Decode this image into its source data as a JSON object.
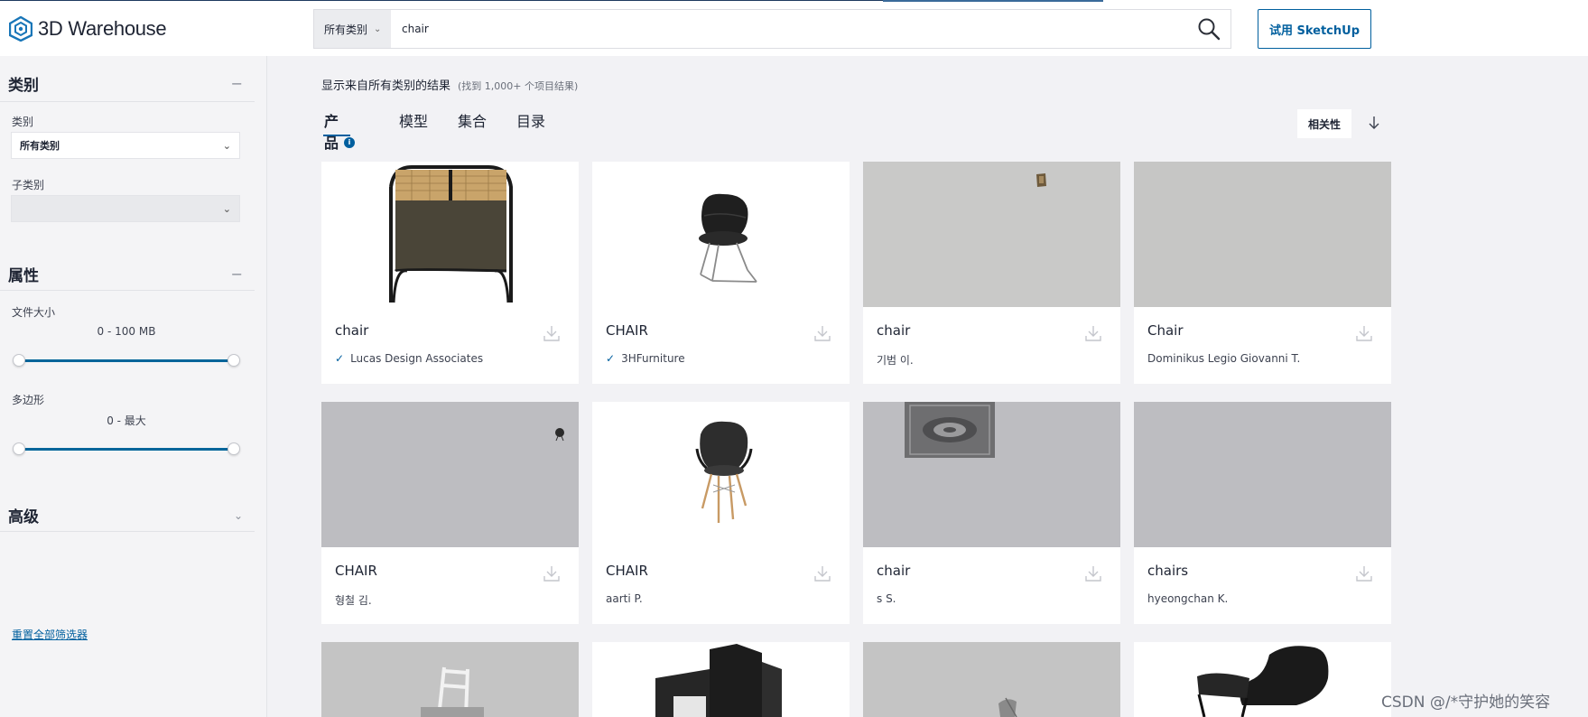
{
  "header": {
    "logo_text": "3D Warehouse",
    "search_category": "所有类别",
    "search_value": "chair",
    "try_button": "试用 SketchUp"
  },
  "sidebar": {
    "category_section": "类别",
    "category_label": "类别",
    "category_value": "所有类别",
    "subcategory_label": "子类别",
    "subcategory_value": "",
    "attributes_section": "属性",
    "filesize_label": "文件大小",
    "filesize_range": "0 - 100 MB",
    "polygon_label": "多边形",
    "polygon_range": "0 - 最大",
    "advanced_section": "高级",
    "reset_link": "重置全部筛选器"
  },
  "main": {
    "result_text": "显示来自所有类别的结果",
    "result_count": "(找到 1,000+ 个项目结果)",
    "tabs": [
      {
        "label": "产品"
      },
      {
        "label": "模型"
      },
      {
        "label": "集合"
      },
      {
        "label": "目录"
      }
    ],
    "sort_label": "相关性",
    "cards": [
      {
        "title": "chair",
        "author": "Lucas Design Associates",
        "verified": true,
        "thumb_bg": "#ffffff"
      },
      {
        "title": "CHAIR",
        "author": "3HFurniture",
        "verified": true,
        "thumb_bg": "#ffffff"
      },
      {
        "title": "chair",
        "author": "기범 이.",
        "verified": false,
        "thumb_bg": "#c9c9c8"
      },
      {
        "title": "Chair",
        "author": "Dominikus Legio Giovanni T.",
        "verified": false,
        "thumb_bg": "#c6c6c5"
      },
      {
        "title": "CHAIR",
        "author": "형철 김.",
        "verified": false,
        "thumb_bg": "#bdbdc1"
      },
      {
        "title": "CHAIR",
        "author": "aarti P.",
        "verified": false,
        "thumb_bg": "#ffffff"
      },
      {
        "title": "chair",
        "author": "s S.",
        "verified": false,
        "thumb_bg": "#bdbdc1"
      },
      {
        "title": "chairs",
        "author": "hyeongchan K.",
        "verified": false,
        "thumb_bg": "#bdbdc1"
      }
    ]
  },
  "watermark": "CSDN @/*守护她的笑容"
}
